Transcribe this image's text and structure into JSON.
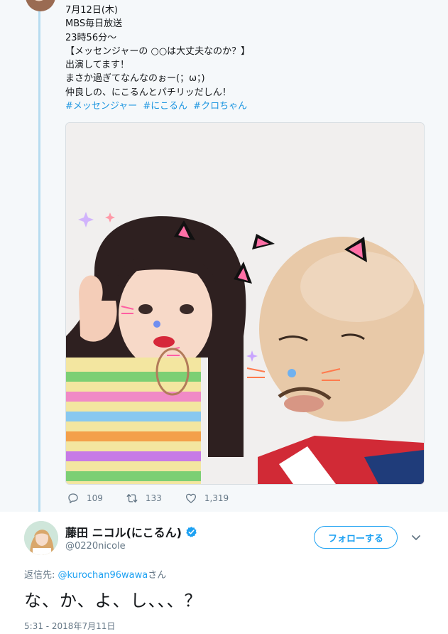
{
  "parent_tweet": {
    "lines": [
      "7月12日(木)",
      "MBS毎日放送",
      "23時56分～",
      "【メッセンジャーの ○○は大丈夫なのか？】",
      "出演してます！",
      "まさか過ぎてなんなのぉー(；ω；)",
      "仲良しの、にこるんとパチリッだしん！"
    ],
    "hashtags": [
      "#メッセンジャー",
      "#にこるん",
      "#クロちゃん"
    ],
    "stats": {
      "replies": "109",
      "retweets": "133",
      "likes": "1,319"
    }
  },
  "reply_tweet": {
    "display_name": "藤田 ニコル(にこるん)",
    "handle": "@0220nicole",
    "follow_label": "フォローする",
    "reply_to_prefix": "返信先: ",
    "reply_to_mention": "@kurochan96wawa",
    "reply_to_suffix": "さん",
    "text": "な、か、よ、し、、、？",
    "timestamp": "5:31 - 2018年7月11日"
  },
  "icons": {
    "reply": "reply-icon",
    "retweet": "retweet-icon",
    "like": "heart-icon",
    "verified": "verified-badge-icon",
    "caret": "chevron-down-icon"
  },
  "colors": {
    "link_blue": "#1da1f2",
    "hashtag_blue": "#1b95e0",
    "thread_line": "#b7dcf0",
    "muted_text": "#657786"
  }
}
